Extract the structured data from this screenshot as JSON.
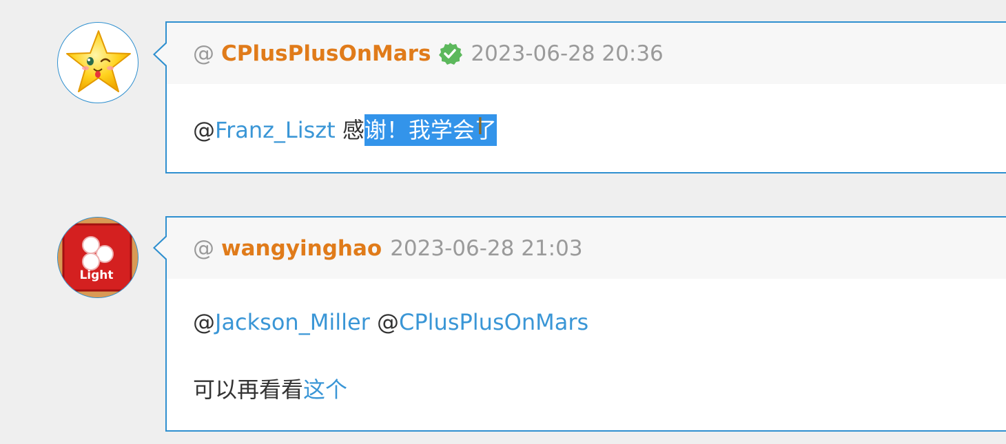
{
  "comments": [
    {
      "username": "CPlusPlusOnMars",
      "verified": true,
      "verified_color": "#5cb85c",
      "avatar_icon": "winking-star-icon",
      "timestamp": "2023-06-28 20:36",
      "at_prefix": "@",
      "body": {
        "mention_at": "@",
        "mention": "Franz_Liszt",
        "text_plain": " 感",
        "text_selected": "谢！我学会了"
      }
    },
    {
      "username": "wangyinghao",
      "verified": false,
      "avatar_icon": "light-game-icon",
      "avatar_label": "Light",
      "timestamp": "2023-06-28 21:03",
      "at_prefix": "@",
      "body": {
        "mention1_at": "@",
        "mention1": "Jackson_Miller",
        "mention2_at": " @",
        "mention2": "CPlusPlusOnMars",
        "line2_text": "可以再看看",
        "line2_link": "这个"
      }
    }
  ],
  "colors": {
    "accent_border": "#2e8fcf",
    "username": "#e07b1a",
    "link": "#3a96d6",
    "selection": "#3394ea"
  }
}
